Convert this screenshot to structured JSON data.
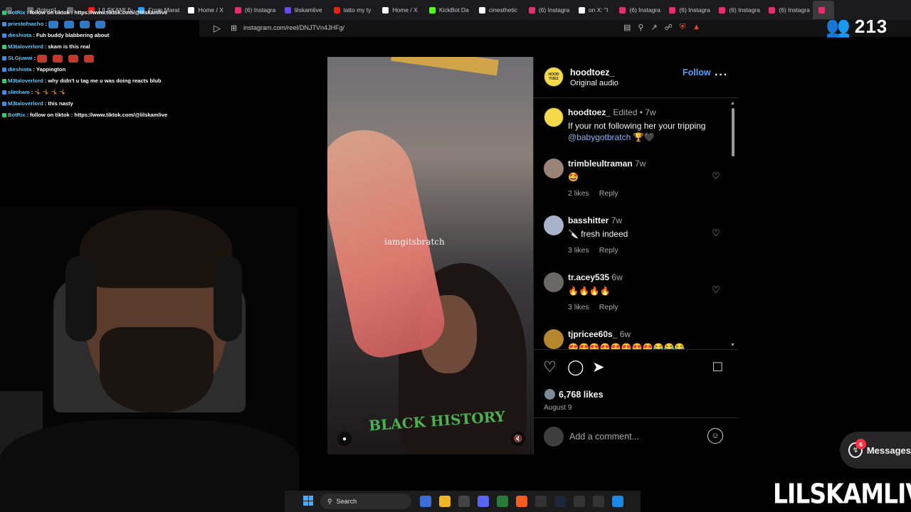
{
  "browser": {
    "tabs": [
      {
        "label": "",
        "color": "#555555"
      },
      {
        "label": "[Interp]",
        "color": "#6a6a6a"
      },
      {
        "label": "",
        "color": "#6a6a6a"
      },
      {
        "label": "LILSKAMLIV",
        "color": "#e62117"
      },
      {
        "label": "From Marat",
        "color": "#2c9af5"
      },
      {
        "label": "Home / X",
        "color": "#ffffff"
      },
      {
        "label": "(6) Instagra",
        "color": "#e1306c"
      },
      {
        "label": "lilskamlive",
        "color": "#6b4be8"
      },
      {
        "label": "latto my ty",
        "color": "#e62117"
      },
      {
        "label": "Home / X",
        "color": "#ffffff"
      },
      {
        "label": "KickBot Da",
        "color": "#53fc18"
      },
      {
        "label": "cinesthetic",
        "color": "#ffffff"
      },
      {
        "label": "(6) Instagra",
        "color": "#e1306c"
      },
      {
        "label": "on X: \"I",
        "color": "#ffffff"
      },
      {
        "label": "(6) Instagra",
        "color": "#e1306c"
      },
      {
        "label": "(6) Instagra",
        "color": "#e1306c"
      },
      {
        "label": "(6) Instagra",
        "color": "#e1306c"
      },
      {
        "label": "(6) Instagra",
        "color": "#e1306c"
      },
      {
        "label": "",
        "color": "#e1306c"
      }
    ],
    "url": "instagram.com/reel/DNJTVn4JHFg/"
  },
  "stream_overlay": {
    "viewer_count": "213",
    "brand": "LILSKAMLIVE",
    "chat": [
      {
        "user": "BotRix",
        "message": "follow on tiktok : https://www.tiktok.com/@lilskamlive",
        "emotes": 0
      },
      {
        "user": "priestofnacho",
        "message": "",
        "emotes": 4,
        "emote_color": "blue"
      },
      {
        "user": "dieshiota",
        "message": "Fuh buddy blabbering about",
        "emotes": 0
      },
      {
        "user": "M3taloverlord",
        "message": "skam is this real",
        "emotes": 0
      },
      {
        "user": "SLGjuwai",
        "message": "",
        "emotes": 4,
        "emote_color": "red"
      },
      {
        "user": "dieshiota",
        "message": "Yappington",
        "emotes": 0
      },
      {
        "user": "M3taloverlord",
        "message": "why didn't u tag me u was doing reacts blub",
        "emotes": 0
      },
      {
        "user": "slimham",
        "message": "🤸 🤸 🤸 🤸",
        "emotes": 0
      },
      {
        "user": "M3taloverlord",
        "message": "this nasty",
        "emotes": 0
      },
      {
        "user": "BotRix",
        "message": "follow on tiktok : https://www.tiktok.com/@lilskamlive",
        "emotes": 0
      }
    ]
  },
  "reel": {
    "watermark": "iamgitsbratch",
    "shirt_text": "BLACK HISTORY"
  },
  "post": {
    "author": "hoodtoez_",
    "audio": "Original audio",
    "follow_label": "Follow",
    "avatar_text": "HOOD TOEZ",
    "caption": {
      "author": "hoodtoez_",
      "edited": "Edited •",
      "time": "7w",
      "text": "If your not following her your tripping",
      "mention": "@babygotbratch",
      "trailing": "🏆🖤"
    },
    "comments": [
      {
        "user": "trimbleultraman",
        "time": "7w",
        "text": "🤩",
        "likes": "2 likes",
        "reply": "Reply",
        "avatar_color": "#9a8478"
      },
      {
        "user": "basshitter",
        "time": "7w",
        "text": "🔪 fresh indeed",
        "likes": "3 likes",
        "reply": "Reply",
        "avatar_color": "#a7b3c9"
      },
      {
        "user": "tr.acey535",
        "time": "6w",
        "text": "🔥🔥🔥🔥",
        "likes": "3 likes",
        "reply": "Reply",
        "avatar_color": "#6c6767"
      },
      {
        "user": "tjpricee60s_",
        "time": "6w",
        "text": "😍😍😍😍😍😍😍😍😂😂😂",
        "likes": "",
        "reply": "",
        "avatar_color": "#b6862c"
      }
    ],
    "likes": "6,768 likes",
    "date": "August 9",
    "comment_placeholder": "Add a comment..."
  },
  "messages": {
    "label": "Messages",
    "badge": "6"
  },
  "taskbar": {
    "search_label": "Search"
  }
}
